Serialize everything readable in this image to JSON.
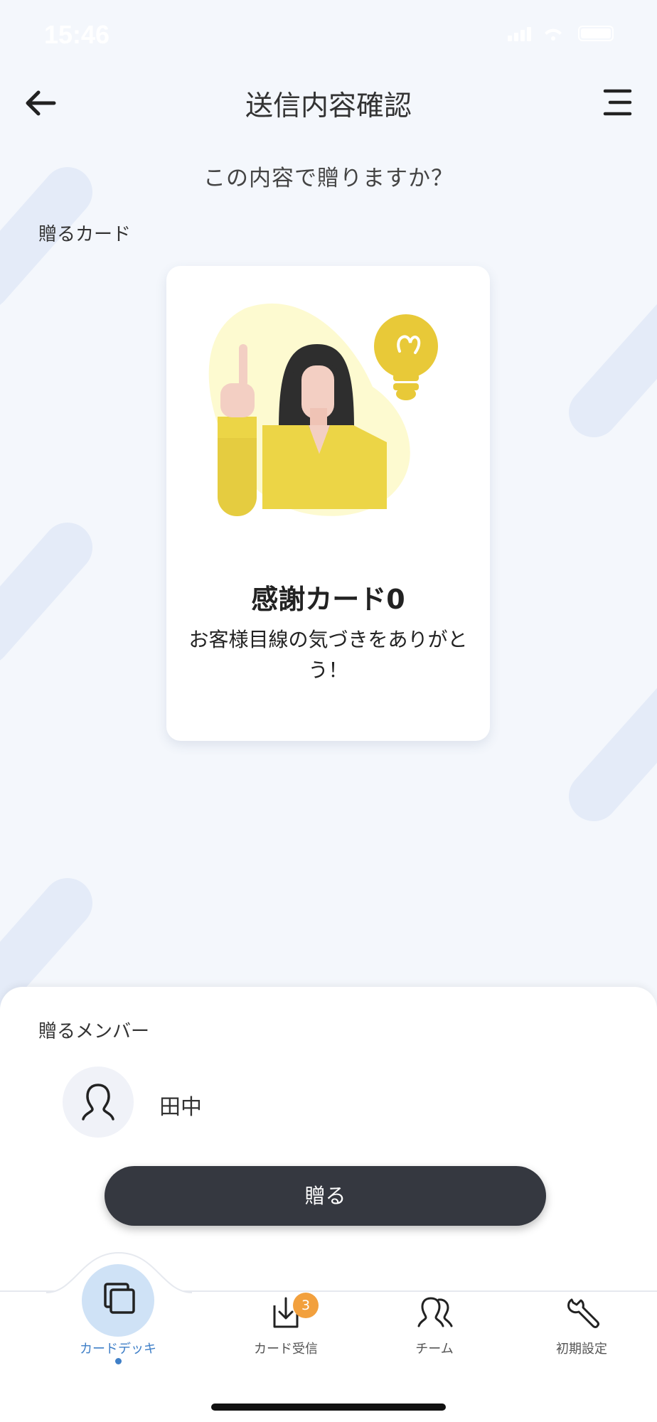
{
  "status_bar": {
    "time": "15:46"
  },
  "header": {
    "title": "送信内容確認"
  },
  "question": "この内容で贈りますか？",
  "card_section": {
    "label": "贈るカード",
    "card": {
      "title": "感謝カード0",
      "description": "お客様目線の気づきをありがとう！"
    }
  },
  "member_section": {
    "label": "贈るメンバー",
    "members": [
      {
        "name": "田中"
      }
    ]
  },
  "send_button": {
    "label": "贈る"
  },
  "tab_bar": {
    "tabs": [
      {
        "label": "カードデッキ",
        "icon": "cards-icon",
        "active": true
      },
      {
        "label": "カード受信",
        "icon": "inbox-download-icon",
        "badge": "3"
      },
      {
        "label": "チーム",
        "icon": "team-icon"
      },
      {
        "label": "初期設定",
        "icon": "wrench-icon"
      }
    ]
  },
  "colors": {
    "background": "#f4f7fc",
    "button": "#353840",
    "accent": "#3f7fc7",
    "badge": "#f2a03d",
    "illustration": "#f0d84a"
  }
}
